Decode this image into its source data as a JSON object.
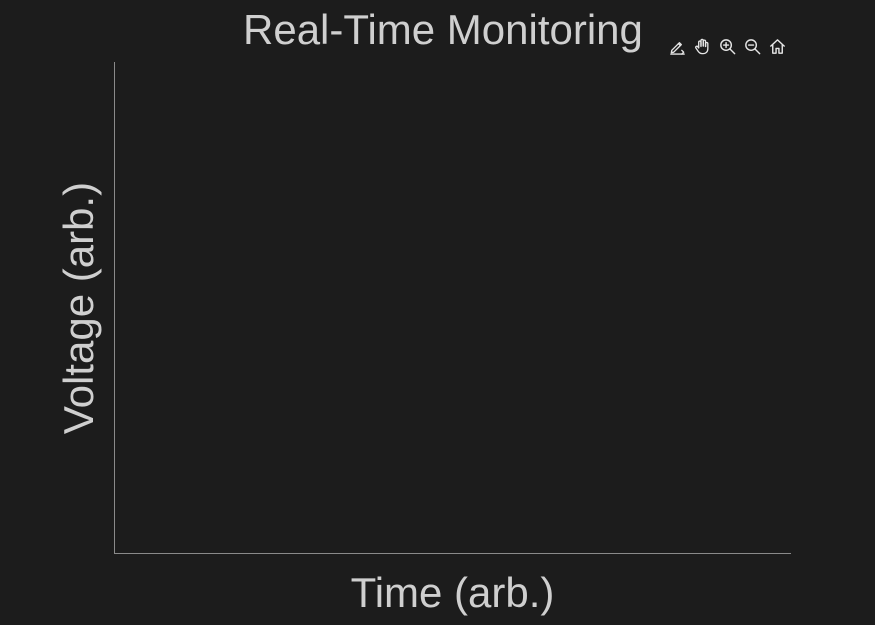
{
  "window": {
    "title": "Real-Time Monitoring"
  },
  "toolbar": {
    "icons": [
      "edit-icon",
      "pan-icon",
      "zoom-in-icon",
      "zoom-out-icon",
      "home-icon"
    ],
    "icon_color": "#e6e6e6"
  },
  "chart_data": {
    "type": "line",
    "title": "Real-Time Monitoring",
    "xlabel": "Time (arb.)",
    "ylabel": "Voltage (arb.)",
    "series": [],
    "grid": false
  },
  "colors": {
    "background": "#1c1c1c",
    "text": "#cfcfcf",
    "axis": "#8a8a8a"
  }
}
